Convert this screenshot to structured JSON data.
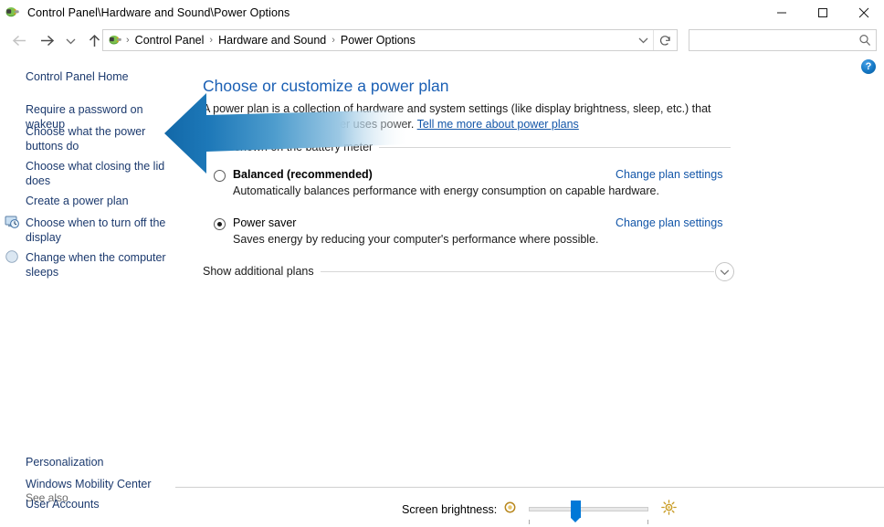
{
  "window": {
    "title": "Control Panel\\Hardware and Sound\\Power Options",
    "app_icon": "power-plug-icon",
    "minimize_label": "—",
    "maximize_label": "□",
    "close_label": "✕"
  },
  "toolbar": {
    "back_icon": "arrow-left-icon",
    "forward_icon": "arrow-right-icon",
    "recent_icon": "chevron-down-icon",
    "up_icon": "arrow-up-icon",
    "refresh_icon": "refresh-icon",
    "dropdown_icon": "chevron-down-icon",
    "breadcrumbs": [
      "Control Panel",
      "Hardware and Sound",
      "Power Options"
    ],
    "separator": "›",
    "search_value": "",
    "search_placeholder": "",
    "search_icon": "search-icon"
  },
  "help": {
    "label": "?",
    "icon": "help-circle-icon"
  },
  "sidebar": {
    "home_label": "Control Panel Home",
    "items": [
      {
        "label": "Require a password on wakeup",
        "icon": null
      },
      {
        "label": "Choose what the power buttons do",
        "icon": null
      },
      {
        "label": "Choose what closing the lid does",
        "icon": null
      },
      {
        "label": "Create a power plan",
        "icon": null
      },
      {
        "label": "Choose when to turn off the display",
        "icon": "display-clock-icon"
      },
      {
        "label": "Change when the computer sleeps",
        "icon": "moon-icon"
      }
    ],
    "see_also_label": "See also",
    "see_also_items": [
      "Personalization",
      "Windows Mobility Center",
      "User Accounts"
    ]
  },
  "main": {
    "title": "Choose or customize a power plan",
    "description_before": "A power plan is a collection of hardware and system settings (like display brightness, sleep, etc.) that manages how your computer uses power. ",
    "description_link": "Tell me more about power plans",
    "section_label": "Plans shown on the battery meter",
    "plans": [
      {
        "name": "Balanced (recommended)",
        "description": "Automatically balances performance with energy consumption on capable hardware.",
        "link": "Change plan settings",
        "selected": false,
        "bold": true
      },
      {
        "name": "Power saver",
        "description": "Saves energy by reducing your computer's performance where possible.",
        "link": "Change plan settings",
        "selected": true,
        "bold": false
      }
    ],
    "additional_plans_label": "Show additional plans",
    "additional_plans_icon": "chevron-down-icon"
  },
  "brightness": {
    "label": "Screen brightness:",
    "low_icon": "dim-sun-icon",
    "high_icon": "bright-sun-icon",
    "value_percent": 38
  },
  "annotation": {
    "type": "arrow-left-annotation",
    "color_start": "#1b6fb0",
    "color_end": "#cfe3f2"
  }
}
